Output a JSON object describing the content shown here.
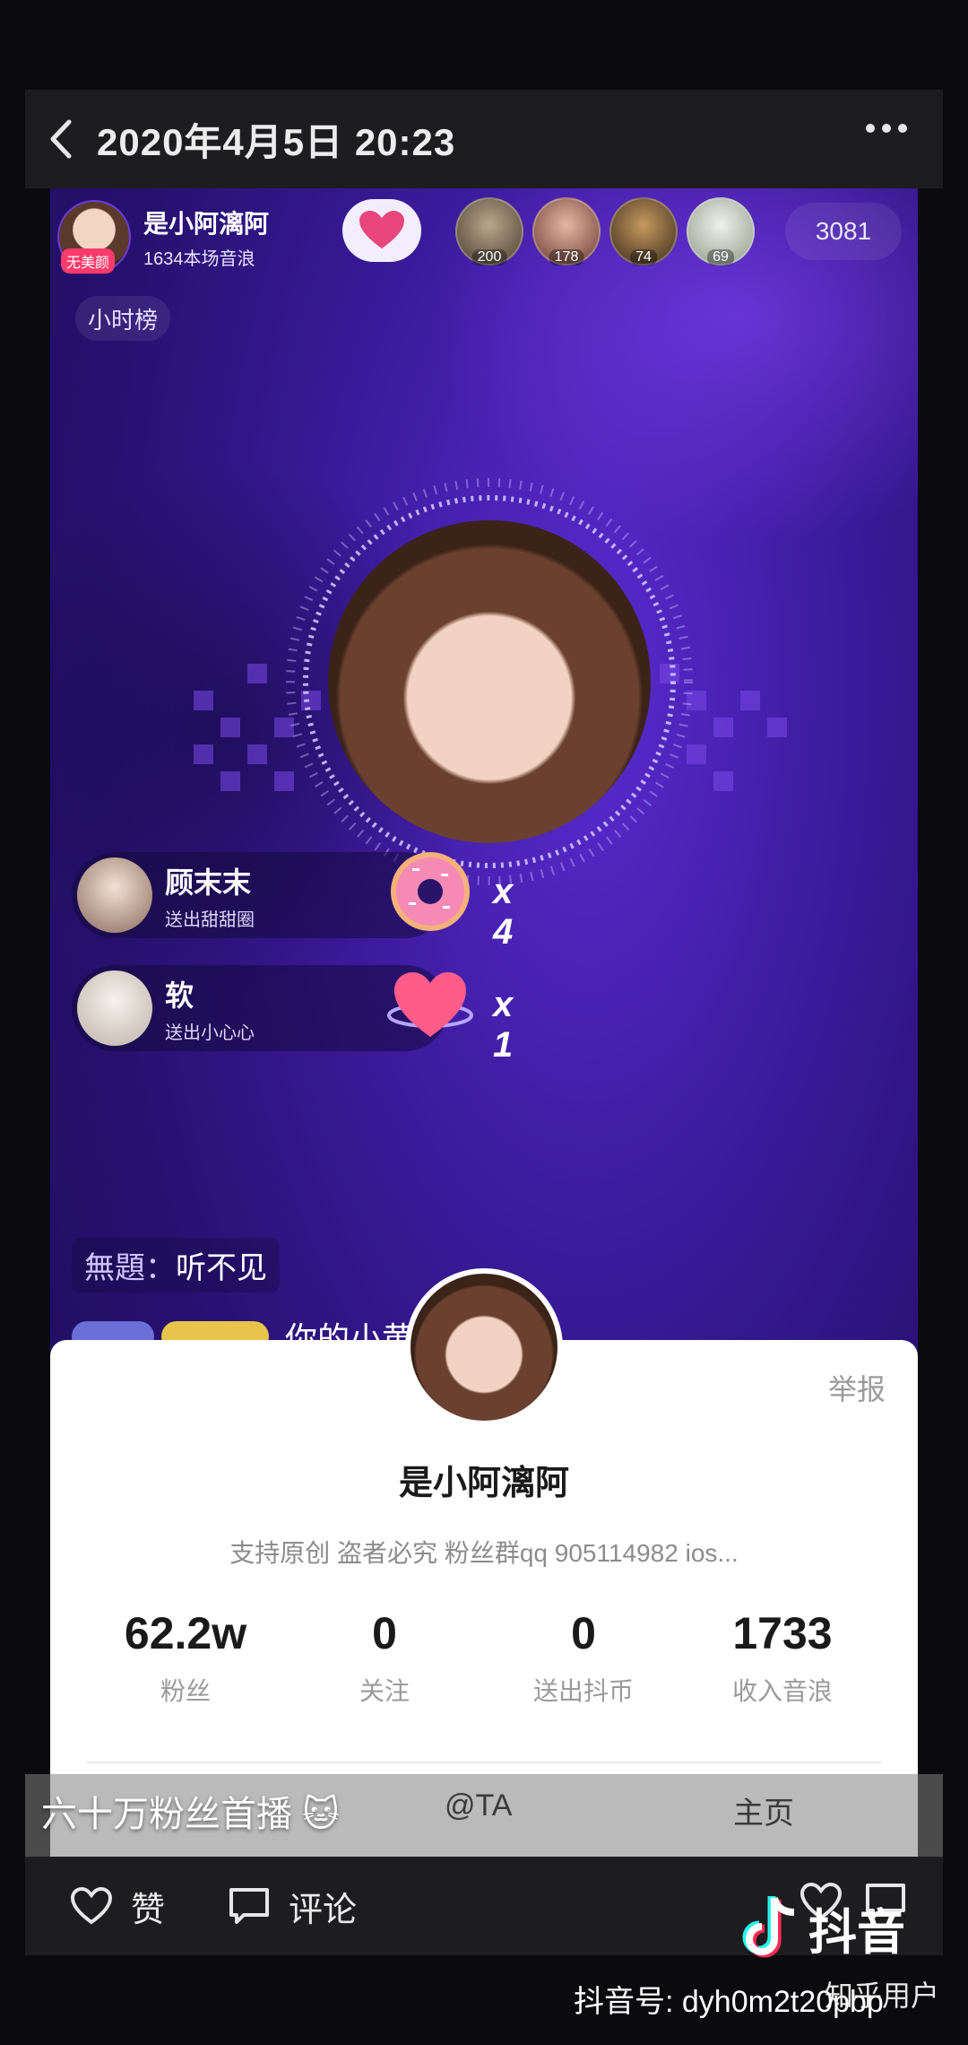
{
  "header": {
    "title": "2020年4月5日 20:23"
  },
  "live": {
    "host": {
      "name": "是小阿漓阿",
      "subtitle": "1634本场音浪",
      "tag": "无美颜"
    },
    "viewers": [
      {
        "count": "200"
      },
      {
        "count": "178"
      },
      {
        "count": "74"
      },
      {
        "count": "69"
      }
    ],
    "viewer_total": "3081",
    "hour_rank": "小时榜",
    "gifts": [
      {
        "name": "顾末末",
        "desc": "送出甜甜圈",
        "count": "x 4",
        "icon": "donut-icon"
      },
      {
        "name": "软",
        "desc": "送出小心心",
        "count": "x 1",
        "icon": "heart-icon"
      }
    ],
    "chat": {
      "user": "無題：",
      "text": "听不见",
      "partial": "你的小黄 ... 哈"
    }
  },
  "profile_card": {
    "report": "举报",
    "name": "是小阿漓阿",
    "bio": "支持原创 盗者必究 粉丝群qq 905114982 ios...",
    "stats": [
      {
        "value": "62.2w",
        "label": "粉丝"
      },
      {
        "value": "0",
        "label": "关注"
      },
      {
        "value": "0",
        "label": "送出抖币"
      },
      {
        "value": "1733",
        "label": "收入音浪"
      }
    ],
    "actions": [
      "@TA",
      "主页"
    ]
  },
  "caption": "六十万粉丝首播 🐱",
  "bottom_bar": {
    "like": "赞",
    "comment": "评论"
  },
  "watermark": {
    "brand": "抖音",
    "douyin_id": "抖音号: dyh0m2t20pbp",
    "zhihu": "知乎用户"
  },
  "colors": {
    "live_bg": "#26116f",
    "accent": "#6c3bd8",
    "card_bg": "#ffffff"
  }
}
